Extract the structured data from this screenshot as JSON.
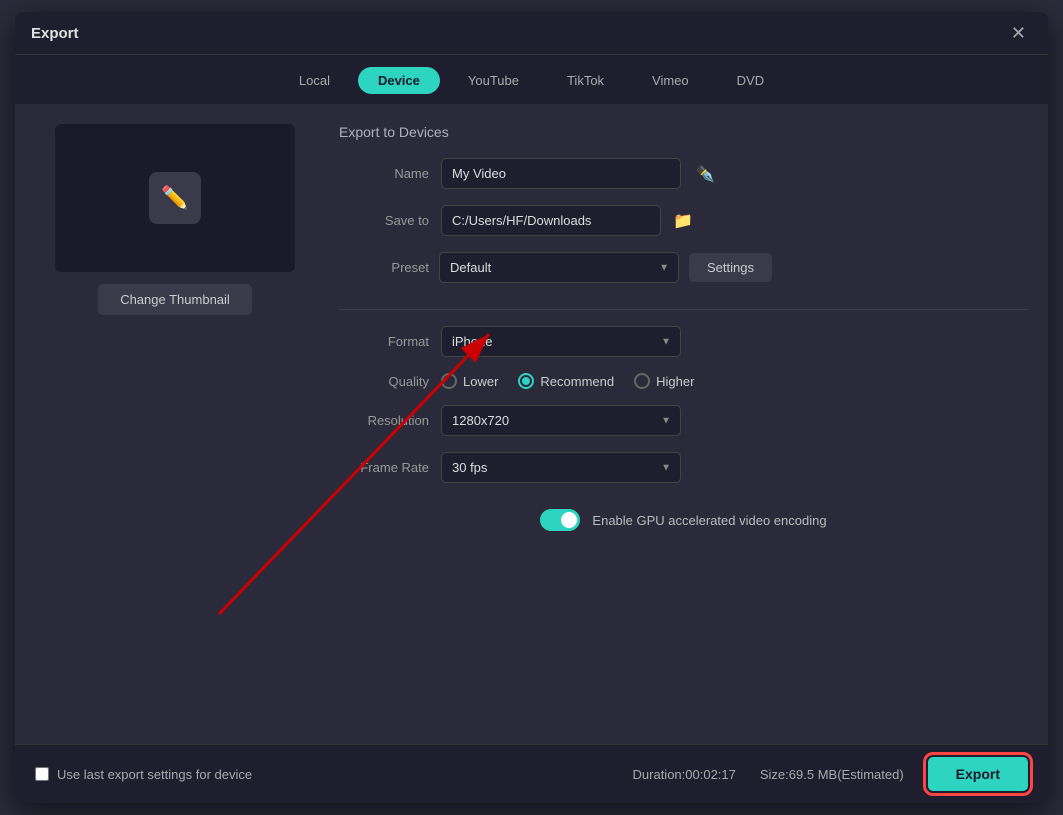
{
  "dialog": {
    "title": "Export",
    "close_label": "✕"
  },
  "tabs": [
    {
      "id": "local",
      "label": "Local",
      "active": false
    },
    {
      "id": "device",
      "label": "Device",
      "active": true
    },
    {
      "id": "youtube",
      "label": "YouTube",
      "active": false
    },
    {
      "id": "tiktok",
      "label": "TikTok",
      "active": false
    },
    {
      "id": "vimeo",
      "label": "Vimeo",
      "active": false
    },
    {
      "id": "dvd",
      "label": "DVD",
      "active": false
    }
  ],
  "export_section": {
    "title": "Export to Devices",
    "name_label": "Name",
    "name_value": "My Video",
    "save_to_label": "Save to",
    "save_path": "C:/Users/HF/Downloads",
    "preset_label": "Preset",
    "preset_value": "Default",
    "settings_label": "Settings",
    "format_label": "Format",
    "format_value": "iPhone",
    "quality_label": "Quality",
    "quality_options": [
      {
        "id": "lower",
        "label": "Lower",
        "selected": false
      },
      {
        "id": "recommend",
        "label": "Recommend",
        "selected": true
      },
      {
        "id": "higher",
        "label": "Higher",
        "selected": false
      }
    ],
    "resolution_label": "Resolution",
    "resolution_value": "1280x720",
    "framerate_label": "Frame Rate",
    "framerate_value": "30 fps",
    "gpu_label": "Enable GPU accelerated video encoding",
    "gpu_enabled": true
  },
  "thumbnail": {
    "change_label": "Change Thumbnail"
  },
  "footer": {
    "use_last_settings_label": "Use last export settings for device",
    "duration_label": "Duration:00:02:17",
    "size_label": "Size:69.5 MB(Estimated)",
    "export_label": "Export"
  }
}
